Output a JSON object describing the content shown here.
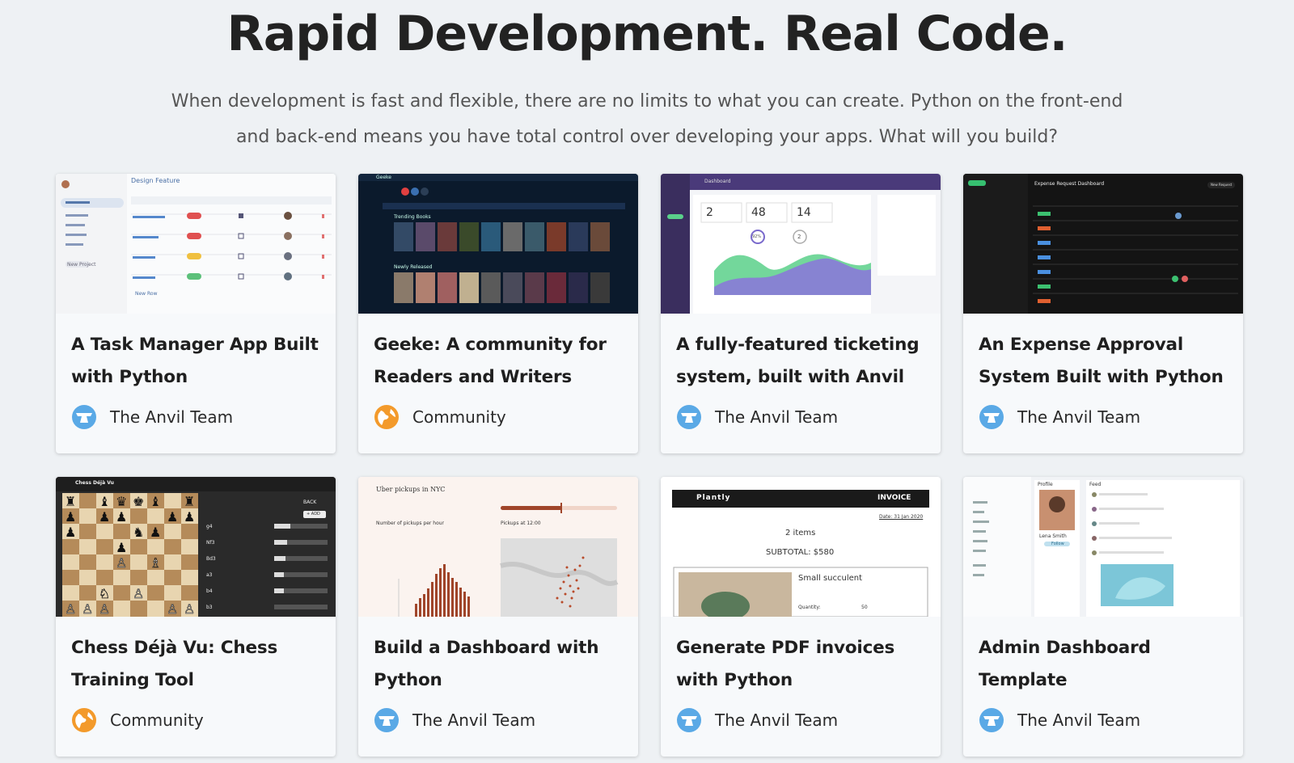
{
  "hero": {
    "headline": "Rapid Development. Real Code.",
    "subtitle": "When development is fast and flexible, there are no limits to what you can create. Python on the front-end and back-end means you have total control over developing your apps. What will you build?"
  },
  "cards": [
    {
      "title": "A Task Manager App Built with Python",
      "author": "The Anvil Team",
      "author_icon": "anvil-logo-icon",
      "thumb": {
        "title": "Design Feature",
        "new_row": "New Row",
        "new_project": "New Project"
      }
    },
    {
      "title": "Geeke: A community for Readers and Writers",
      "author": "Community",
      "author_icon": "community-globe-icon",
      "thumb": {
        "app_name": "Geeke",
        "trending": "Trending Books",
        "newly": "Newly Released"
      }
    },
    {
      "title": "A fully-featured ticketing system, built with Anvil",
      "author": "The Anvil Team",
      "author_icon": "anvil-logo-icon",
      "thumb": {
        "header": "Dashboard",
        "stat1": "2",
        "stat2": "48",
        "stat3": "14",
        "pct": "92%",
        "stat4": "2"
      }
    },
    {
      "title": "An Expense Approval System Built with Python",
      "author": "The Anvil Team",
      "author_icon": "anvil-logo-icon",
      "thumb": {
        "title": "Expense Request Dashboard",
        "new_request": "New Request"
      }
    },
    {
      "title": "Chess Déjà Vu: Chess Training Tool",
      "author": "Community",
      "author_icon": "community-globe-icon",
      "thumb": {
        "app_name": "Chess Déjà Vu",
        "back": "BACK",
        "add": "+ ADD",
        "moves": [
          "g4",
          "Nf3",
          "Bd3",
          "a3",
          "b4",
          "b3"
        ]
      }
    },
    {
      "title": "Build a Dashboard with Python",
      "author": "The Anvil Team",
      "author_icon": "anvil-logo-icon",
      "thumb": {
        "title": "Uber pickups in NYC",
        "left_label": "Number of pickups per hour",
        "right_label": "Pickups at 12:00"
      }
    },
    {
      "title": "Generate PDF invoices with Python",
      "author": "The Anvil Team",
      "author_icon": "anvil-logo-icon",
      "thumb": {
        "brand": "Plantly",
        "doc": "INVOICE",
        "date": "Date: 31 Jan 2020",
        "items": "2 items",
        "subtotal": "SUBTOTAL: $580",
        "item": "Small succulent",
        "qty_label": "Quantity:",
        "qty": "50"
      }
    },
    {
      "title": "Admin Dashboard Template",
      "author": "The Anvil Team",
      "author_icon": "anvil-logo-icon",
      "thumb": {
        "profile": "Profile",
        "feed": "Feed",
        "name": "Lena Smith",
        "follow": "Follow"
      }
    }
  ],
  "colors": {
    "page_bg": "#eef1f4",
    "card_bg": "#f7f9fb",
    "anvil_blue": "#5aa9e6",
    "community_orange": "#f39a2b"
  }
}
